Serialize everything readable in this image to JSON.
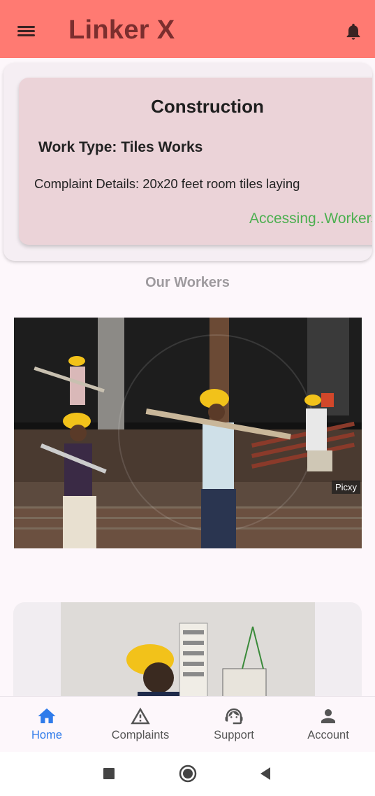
{
  "app": {
    "title": "Linker X"
  },
  "header": {
    "menu_icon": "menu-icon",
    "notification_icon": "bell-icon"
  },
  "complaint_card": {
    "title": "Construction",
    "work_type": "Work Type: Tiles Works",
    "details": "Complaint Details: 20x20 feet room tiles laying",
    "status": "Accessing..Workers"
  },
  "workers_section": {
    "title": "Our Workers",
    "image_watermark": "Picxy"
  },
  "bottom_nav": {
    "items": [
      {
        "label": "Home",
        "icon": "home-icon",
        "active": true
      },
      {
        "label": "Complaints",
        "icon": "warning-icon",
        "active": false
      },
      {
        "label": "Support",
        "icon": "support-agent-icon",
        "active": false
      },
      {
        "label": "Account",
        "icon": "person-icon",
        "active": false
      }
    ]
  },
  "system_nav": {
    "icons": [
      "recents-icon",
      "home-circle-icon",
      "back-icon"
    ]
  },
  "colors": {
    "app_bar": "#ff7a72",
    "title": "#7b2e2e",
    "status_green": "#4caf50",
    "nav_active": "#2f7bea",
    "card_bg": "#ebd3d8"
  }
}
